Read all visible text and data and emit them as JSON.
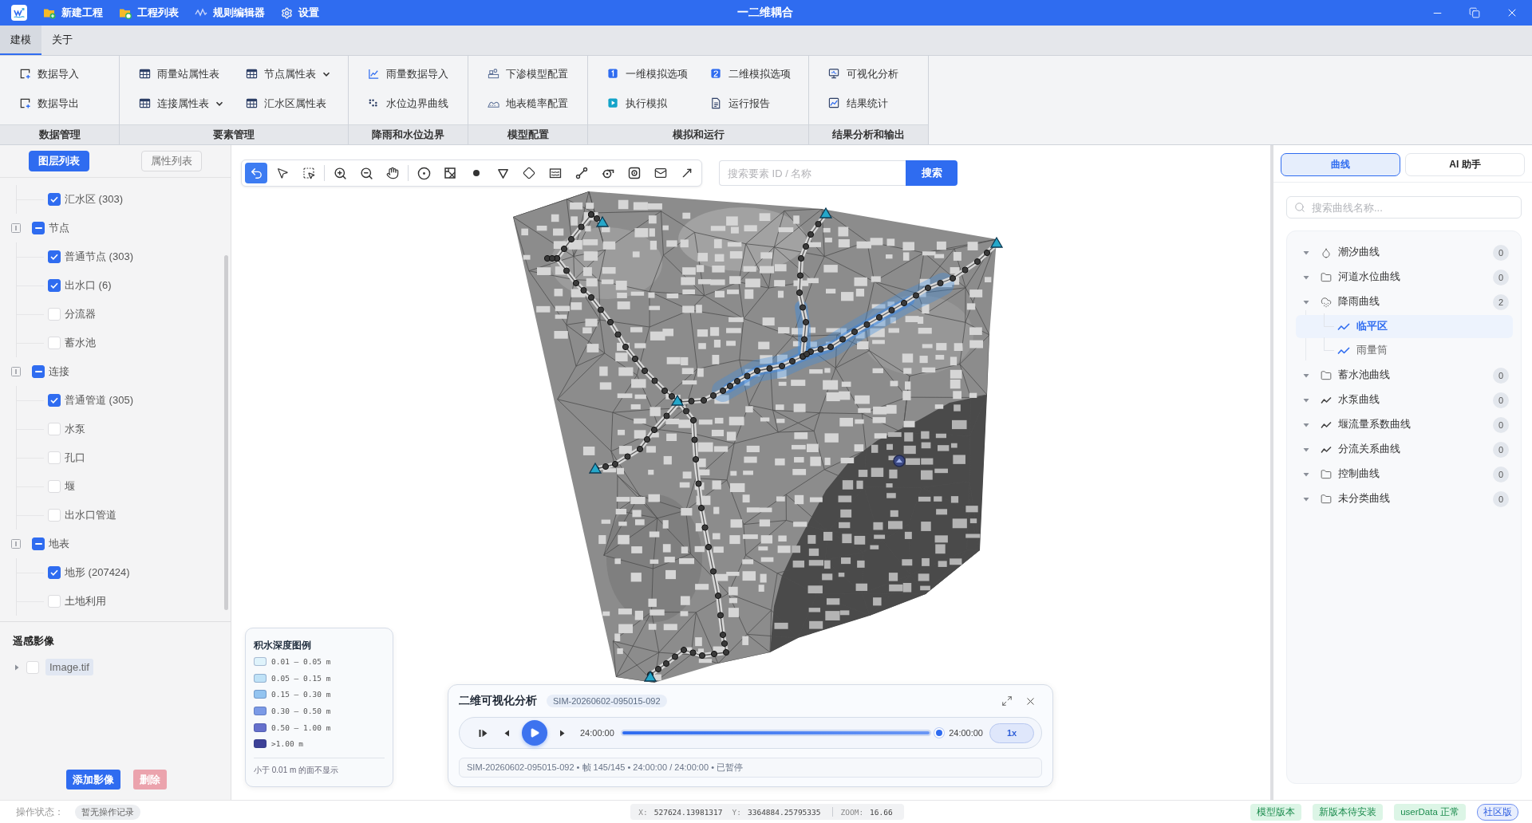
{
  "title_bar": {
    "menu": [
      {
        "label": "新建工程",
        "kind": "new-project"
      },
      {
        "label": "工程列表",
        "kind": "project-list"
      },
      {
        "label": "规则编辑器",
        "kind": "rule-editor"
      },
      {
        "label": "设置",
        "kind": "settings"
      }
    ],
    "title": "一二维耦合"
  },
  "menu_tabs": [
    {
      "label": "建模",
      "selected": true
    },
    {
      "label": "关于",
      "selected": false
    }
  ],
  "ribbon": {
    "groups": [
      {
        "label": "数据管理",
        "items": [
          {
            "label": "数据导入",
            "kind": "import",
            "dropdown": false
          },
          {
            "label": "数据导出",
            "kind": "export",
            "dropdown": false
          }
        ]
      },
      {
        "label": "要素管理",
        "items": [
          {
            "label": "雨量站属性表",
            "kind": "table",
            "dropdown": false
          },
          {
            "label": "节点属性表",
            "kind": "table",
            "dropdown": true
          },
          {
            "label": "连接属性表",
            "kind": "table",
            "dropdown": true
          },
          {
            "label": "汇水区属性表",
            "kind": "table",
            "dropdown": false
          }
        ]
      },
      {
        "label": "降雨和水位边界",
        "items": [
          {
            "label": "雨量数据导入",
            "kind": "rain-import",
            "dropdown": false
          },
          {
            "label": "水位边界曲线",
            "kind": "level-curve",
            "dropdown": false
          }
        ]
      },
      {
        "label": "模型配置",
        "items": [
          {
            "label": "下渗模型配置",
            "kind": "infiltration",
            "dropdown": false
          },
          {
            "label": "地表糙率配置",
            "kind": "roughness",
            "dropdown": false
          }
        ]
      },
      {
        "label": "模拟和运行",
        "items": [
          {
            "label": "一维模拟选项",
            "kind": "options-1d",
            "dropdown": false
          },
          {
            "label": "二维模拟选项",
            "kind": "options-2d",
            "dropdown": false
          },
          {
            "label": "执行模拟",
            "kind": "run",
            "dropdown": false
          },
          {
            "label": "运行报告",
            "kind": "report",
            "dropdown": false
          }
        ]
      },
      {
        "label": "结果分析和输出",
        "items": [
          {
            "label": "可视化分析",
            "kind": "visual",
            "dropdown": false
          },
          {
            "label": "结果统计",
            "kind": "stats",
            "dropdown": false
          }
        ]
      }
    ]
  },
  "layer_panel": {
    "tabs": [
      {
        "label": "图层列表",
        "selected": true
      },
      {
        "label": "属性列表",
        "selected": false
      }
    ],
    "tree": [
      {
        "children": [
          {
            "label": "汇水区 (303)",
            "checked": true
          }
        ]
      },
      {
        "label": "节点",
        "checked": true,
        "partial": true,
        "expanded": true,
        "children": [
          {
            "label": "普通节点 (303)",
            "checked": true
          },
          {
            "label": "出水口 (6)",
            "checked": true
          },
          {
            "label": "分流器",
            "checked": false
          },
          {
            "label": "蓄水池",
            "checked": false
          }
        ]
      },
      {
        "label": "连接",
        "checked": true,
        "partial": true,
        "expanded": true,
        "children": [
          {
            "label": "普通管道 (305)",
            "checked": true
          },
          {
            "label": "水泵",
            "checked": false
          },
          {
            "label": "孔口",
            "checked": false
          },
          {
            "label": "堰",
            "checked": false
          },
          {
            "label": "出水口管道",
            "checked": false
          }
        ]
      },
      {
        "label": "地表",
        "checked": true,
        "partial": true,
        "expanded": true,
        "children": [
          {
            "label": "地形 (207424)",
            "checked": true
          },
          {
            "label": "土地利用",
            "checked": false
          }
        ]
      }
    ],
    "imagery": {
      "title": "遥感影像",
      "items": [
        {
          "label": "Image.tif",
          "checked": false,
          "selected": true,
          "expanded": false
        }
      ]
    },
    "buttons": [
      {
        "label": "添加影像",
        "kind": "primary",
        "disabled": false
      },
      {
        "label": "删除",
        "kind": "danger",
        "disabled": true
      }
    ]
  },
  "map": {
    "tool_groups": [
      [
        {
          "kind": "back",
          "selected": true
        },
        {
          "kind": "pointer",
          "selected": false
        },
        {
          "kind": "box-select",
          "selected": false
        }
      ],
      [
        {
          "kind": "zoom-in",
          "selected": false
        },
        {
          "kind": "zoom-out",
          "selected": false
        },
        {
          "kind": "pan",
          "selected": false
        }
      ],
      [
        {
          "kind": "junction",
          "selected": false
        },
        {
          "kind": "raster",
          "selected": false
        },
        {
          "kind": "node",
          "selected": false
        },
        {
          "kind": "outfall",
          "selected": false
        },
        {
          "kind": "divider",
          "selected": false
        },
        {
          "kind": "storage",
          "selected": false
        },
        {
          "kind": "conduit",
          "selected": false
        },
        {
          "kind": "pump",
          "selected": false
        },
        {
          "kind": "orifice",
          "selected": false
        },
        {
          "kind": "weir",
          "selected": false
        },
        {
          "kind": "outlet",
          "selected": false
        }
      ]
    ],
    "search": {
      "placeholder": "搜索要素 ID / 名称",
      "button": "搜索"
    },
    "legend": {
      "title": "积水深度图例",
      "items": [
        {
          "label": "0.01 – 0.05 m",
          "color": "#dff3fb"
        },
        {
          "label": "0.05 – 0.15 m",
          "color": "#bfe2f7"
        },
        {
          "label": "0.15 – 0.30 m",
          "color": "#93c4f0"
        },
        {
          "label": "0.30 – 0.50 m",
          "color": "#7b9ae6"
        },
        {
          "label": "0.50 – 1.00 m",
          "color": "#6670cc"
        },
        {
          "label": ">1.00 m",
          "color": "#3d4197"
        }
      ],
      "note": "小于 0.01 m 的面不显示"
    },
    "player": {
      "title": "二维可视化分析",
      "run_id": "SIM-20260602-095015-092",
      "playing": false,
      "current_time": "24:00:00",
      "level": 1,
      "end_time": "24:00:00",
      "speed": "1x",
      "info": "SIM-20260602-095015-092 • 帧 145/145 • 24:00:00 / 24:00:00 • 已暂停"
    }
  },
  "curve_panel": {
    "tabs": [
      {
        "label": "曲线",
        "selected": true
      },
      {
        "label": "AI 助手",
        "selected": false
      }
    ],
    "search": {
      "placeholder": "搜索曲线名称..."
    },
    "categories": [
      {
        "label": "潮汐曲线",
        "kind": "tide",
        "count": "0",
        "expanded": true
      },
      {
        "label": "河道水位曲线",
        "kind": "folder",
        "count": "0",
        "expanded": true
      },
      {
        "label": "降雨曲线",
        "kind": "rainfall",
        "count": "2",
        "expanded": true,
        "children": [
          {
            "label": "临平区",
            "selected": true
          },
          {
            "label": "雨量筒",
            "selected": false
          }
        ]
      },
      {
        "label": "蓄水池曲线",
        "kind": "folder",
        "count": "0",
        "expanded": true
      },
      {
        "label": "水泵曲线",
        "kind": "curve",
        "count": "0",
        "expanded": true
      },
      {
        "label": "堰流量系数曲线",
        "kind": "curve",
        "count": "0",
        "expanded": true
      },
      {
        "label": "分流关系曲线",
        "kind": "curve",
        "count": "0",
        "expanded": true
      },
      {
        "label": "控制曲线",
        "kind": "folder",
        "count": "0",
        "expanded": true
      },
      {
        "label": "未分类曲线",
        "kind": "folder",
        "count": "0",
        "expanded": true
      }
    ]
  },
  "status_bar": {
    "label": "操作状态：",
    "status": "暂无操作记录",
    "position": [
      {
        "label": "X:",
        "value": "527624.13981317"
      },
      {
        "label": "Y:",
        "value": "3364884.25795335"
      }
    ],
    "zoom": {
      "label": "ZOOM:",
      "value": "16.66"
    },
    "badges": [
      {
        "label": "模型版本",
        "kind": "ok"
      },
      {
        "label": "新版本待安装",
        "kind": "ok"
      },
      {
        "label": "userData 正常",
        "kind": "ok"
      },
      {
        "label": "社区版",
        "kind": "info"
      }
    ]
  }
}
